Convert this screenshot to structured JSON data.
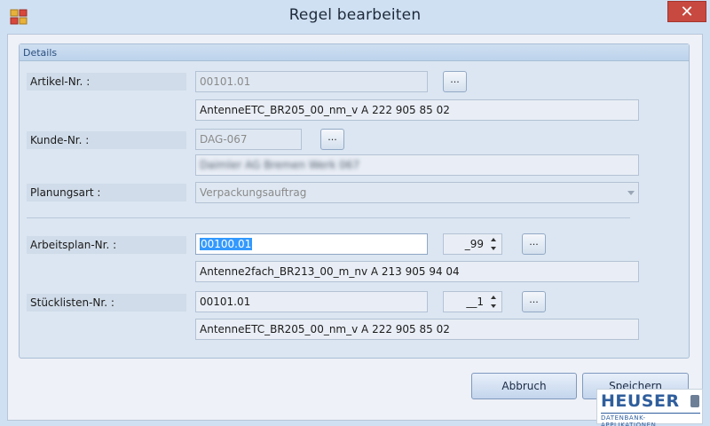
{
  "window": {
    "title": "Regel bearbeiten",
    "close_label": "✕"
  },
  "details": {
    "title": "Details",
    "artikel": {
      "label": "Artikel-Nr. :",
      "value": "00101.01",
      "description": "AntenneETC_BR205_00_nm_v A 222 905 85 02",
      "button": "..."
    },
    "kunde": {
      "label": "Kunde-Nr.  :",
      "value": "DAG-067",
      "description": "Daimler AG Bremen Werk 067",
      "button": "..."
    },
    "planungsart": {
      "label": "Planungsart :",
      "value": "Verpackungsauftrag"
    },
    "arbeitsplan": {
      "label": "Arbeitsplan-Nr. :",
      "value": "00100.01",
      "spin": "_99",
      "description": "Antenne2fach_BR213_00_m_nv A 213 905 94 04",
      "button": "..."
    },
    "stueckliste": {
      "label": "Stücklisten-Nr. :",
      "value": "00101.01",
      "spin": "__1",
      "description": "AntenneETC_BR205_00_nm_v A 222 905 85 02",
      "button": "..."
    }
  },
  "buttons": {
    "cancel": "Abbruch",
    "save": "Speichern"
  },
  "logo": {
    "main": "HEUSER",
    "sub": "DATENBANK-APPLIKATIONEN"
  },
  "colors": {
    "accent": "#2f5e9c",
    "close": "#c7493f",
    "selection": "#3399ff"
  }
}
